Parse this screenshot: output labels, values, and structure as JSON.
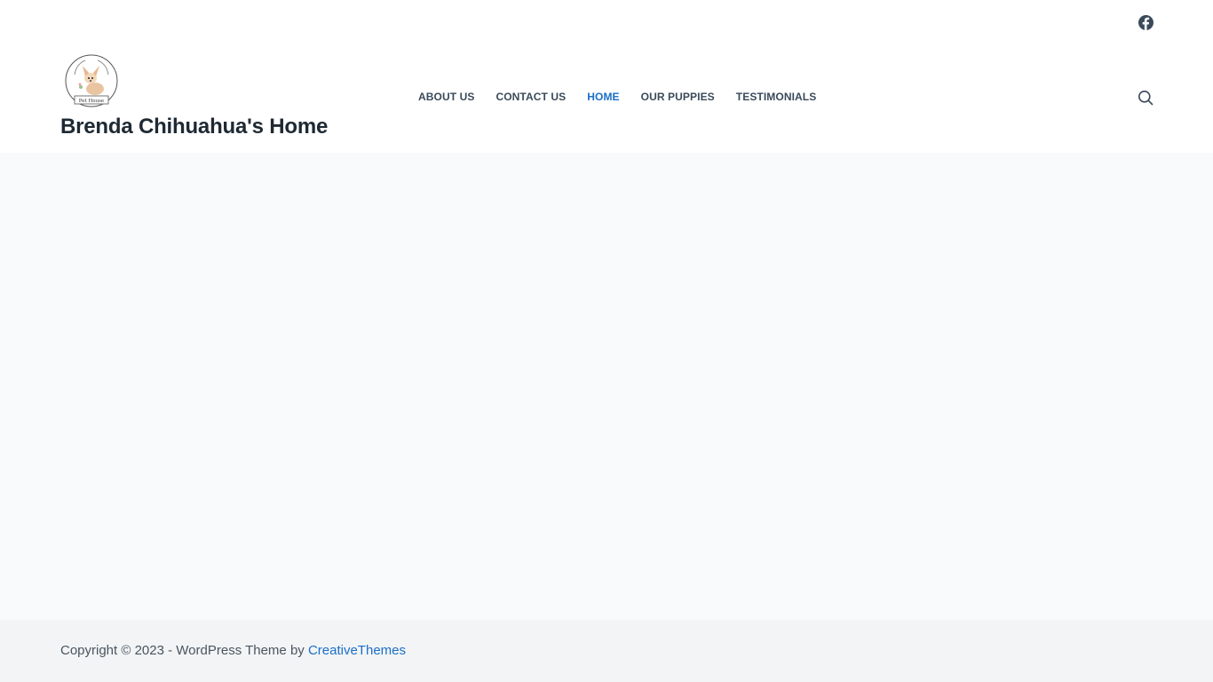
{
  "header": {
    "social": {
      "facebook_icon": "facebook-icon"
    },
    "site_title": "Brenda Chihuahua's Home",
    "logo": {
      "caption": "Pet House",
      "icon": "chihuahua-logo-icon"
    },
    "nav": [
      {
        "label": "ABOUT US",
        "active": false
      },
      {
        "label": "CONTACT US",
        "active": false
      },
      {
        "label": "HOME",
        "active": true
      },
      {
        "label": "OUR PUPPIES",
        "active": false
      },
      {
        "label": "TESTIMONIALS",
        "active": false
      }
    ],
    "search_icon": "search-icon"
  },
  "footer": {
    "copyright_prefix": "Copyright © 2023 - WordPress Theme by ",
    "credit_link": "CreativeThemes"
  },
  "colors": {
    "accent": "#1a6fc7",
    "title": "#1e2933",
    "nav_text": "#3a4a5a",
    "content_bg": "#f8fafc",
    "footer_bg": "#f2f4f6"
  }
}
